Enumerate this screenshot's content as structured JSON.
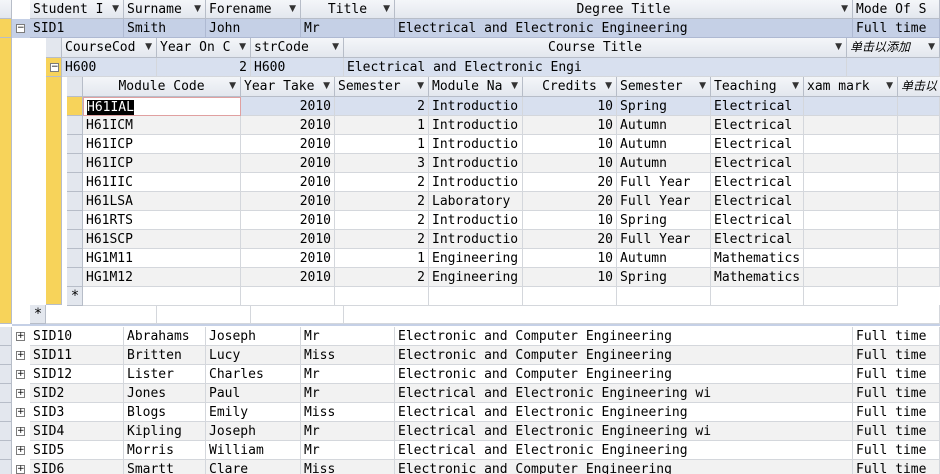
{
  "students_header": {
    "student_id": "Student I",
    "surname": "Surname",
    "forename": "Forename",
    "title": "Title",
    "degree_title": "Degree Title",
    "mode": "Mode Of S"
  },
  "expanded_student": {
    "id": "SID1",
    "surname": "Smith",
    "forename": "John",
    "title": "Mr",
    "degree": "Electrical and Electronic Engineering",
    "mode": "Full time"
  },
  "course_header": {
    "course_code": "CourseCod",
    "year_on_c": "Year On C",
    "str_code": "strCode",
    "course_title": "Course Title",
    "add_new": "单击以添加"
  },
  "course_row": {
    "course_code": "H600",
    "year_on_c": "2",
    "str_code": "H600",
    "course_title": "Electrical and Electronic Engi"
  },
  "module_header": {
    "module_code": "Module Code",
    "year_taken": "Year Take",
    "semester_num": "Semester",
    "module_name": "Module Na",
    "credits": "Credits",
    "semester": "Semester",
    "teaching": "Teaching",
    "exam_mark": "xam mark",
    "add_new": "单击以"
  },
  "modules": [
    {
      "code": "H61IAL",
      "year": "2010",
      "sem_num": "2",
      "name": "Introductio",
      "credits": "10",
      "semester": "Spring",
      "teaching": "Electrical"
    },
    {
      "code": "H61ICM",
      "year": "2010",
      "sem_num": "1",
      "name": "Introductio",
      "credits": "10",
      "semester": "Autumn",
      "teaching": "Electrical"
    },
    {
      "code": "H61ICP",
      "year": "2010",
      "sem_num": "1",
      "name": "Introductio",
      "credits": "10",
      "semester": "Autumn",
      "teaching": "Electrical"
    },
    {
      "code": "H61ICP",
      "year": "2010",
      "sem_num": "3",
      "name": "Introductio",
      "credits": "10",
      "semester": "Autumn",
      "teaching": "Electrical"
    },
    {
      "code": "H61IIC",
      "year": "2010",
      "sem_num": "2",
      "name": "Introductio",
      "credits": "20",
      "semester": "Full Year",
      "teaching": "Electrical"
    },
    {
      "code": "H61LSA",
      "year": "2010",
      "sem_num": "2",
      "name": "Laboratory",
      "credits": "20",
      "semester": "Full Year",
      "teaching": "Electrical"
    },
    {
      "code": "H61RTS",
      "year": "2010",
      "sem_num": "2",
      "name": "Introductio",
      "credits": "10",
      "semester": "Spring",
      "teaching": "Electrical"
    },
    {
      "code": "H61SCP",
      "year": "2010",
      "sem_num": "2",
      "name": "Introductio",
      "credits": "20",
      "semester": "Full Year",
      "teaching": "Electrical"
    },
    {
      "code": "HG1M11",
      "year": "2010",
      "sem_num": "1",
      "name": "Engineering",
      "credits": "10",
      "semester": "Autumn",
      "teaching": "Mathematics"
    },
    {
      "code": "HG1M12",
      "year": "2010",
      "sem_num": "2",
      "name": "Engineering",
      "credits": "10",
      "semester": "Spring",
      "teaching": "Mathematics"
    }
  ],
  "new_record_marker": "*",
  "students": [
    {
      "id": "SID10",
      "surname": "Abrahams",
      "forename": "Joseph",
      "title": "Mr",
      "degree": "Electronic and Computer Engineering",
      "mode": "Full time"
    },
    {
      "id": "SID11",
      "surname": "Britten",
      "forename": "Lucy",
      "title": "Miss",
      "degree": "Electronic and Computer Engineering",
      "mode": "Full time"
    },
    {
      "id": "SID12",
      "surname": "Lister",
      "forename": "Charles",
      "title": "Mr",
      "degree": "Electronic and Computer Engineering",
      "mode": "Full time"
    },
    {
      "id": "SID2",
      "surname": "Jones",
      "forename": "Paul",
      "title": "Mr",
      "degree": "Electrical and Electronic Engineering wi",
      "mode": "Full time"
    },
    {
      "id": "SID3",
      "surname": "Blogs",
      "forename": "Emily",
      "title": "Miss",
      "degree": "Electrical and Electronic Engineering",
      "mode": "Full time"
    },
    {
      "id": "SID4",
      "surname": "Kipling",
      "forename": "Joseph",
      "title": "Mr",
      "degree": "Electrical and Electronic Engineering wi",
      "mode": "Full time"
    },
    {
      "id": "SID5",
      "surname": "Morris",
      "forename": "William",
      "title": "Mr",
      "degree": "Electrical and Electronic Engineering",
      "mode": "Full time"
    },
    {
      "id": "SID6",
      "surname": "Smartt",
      "forename": "Clare",
      "title": "Miss",
      "degree": "Electronic and Computer Engineering",
      "mode": "Full time"
    }
  ],
  "expander_symbols": {
    "collapsed": "+",
    "expanded": "−"
  },
  "colors": {
    "active_row": "#f7d35a",
    "expanded_row": "#c5d0e6",
    "header": "#e3e7ee",
    "selection_border": "#e0a0a0"
  }
}
